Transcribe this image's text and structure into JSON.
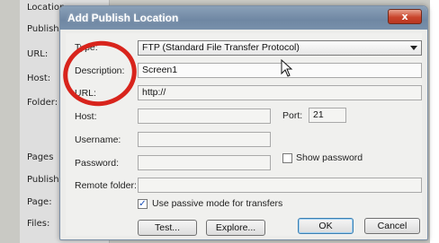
{
  "background_window": {
    "labels": [
      "Location",
      "Publish",
      "URL:",
      "Host:",
      "Folder:",
      "Pages",
      "Publish",
      "Page:",
      "Files:"
    ]
  },
  "dialog": {
    "title": "Add Publish Location",
    "close_label": "x",
    "type": {
      "label": "Type:",
      "value": "FTP (Standard File Transfer Protocol)"
    },
    "description": {
      "label": "Description:",
      "value": "Screen1"
    },
    "url": {
      "label": "URL:",
      "value": "http://"
    },
    "host": {
      "label": "Host:",
      "value": ""
    },
    "port": {
      "label": "Port:",
      "value": "21"
    },
    "username": {
      "label": "Username:",
      "value": ""
    },
    "password": {
      "label": "Password:",
      "value": ""
    },
    "show_password": {
      "label": "Show password",
      "checked": false
    },
    "remote_folder": {
      "label": "Remote folder:",
      "value": ""
    },
    "passive_mode": {
      "label": "Use passive mode for transfers",
      "checked": true
    },
    "buttons": {
      "test": "Test...",
      "explore": "Explore...",
      "ok": "OK",
      "cancel": "Cancel"
    }
  },
  "annotation_color": "#d8241c",
  "icons": [
    "close-icon",
    "dropdown-arrow-icon",
    "mouse-cursor-icon",
    "checkmark-icon"
  ]
}
